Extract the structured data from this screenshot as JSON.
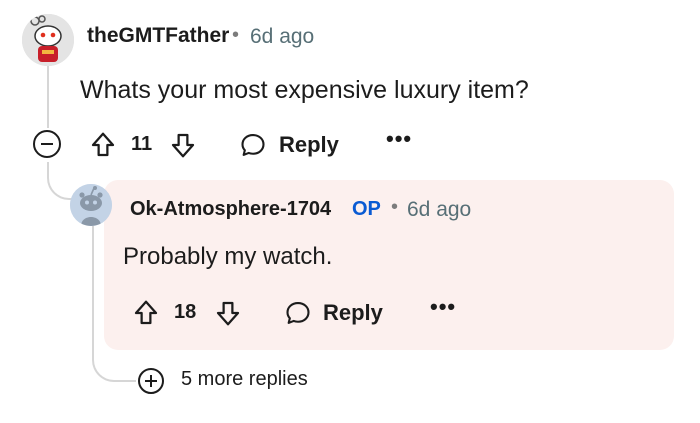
{
  "comment": {
    "username": "theGMTFather",
    "separator": "•",
    "time": "6d ago",
    "body": "Whats your most expensive luxury item?",
    "vote_count": "11",
    "reply_label": "Reply",
    "more_label": "•••"
  },
  "reply": {
    "username": "Ok-Atmosphere-1704",
    "badge": "OP",
    "separator": "•",
    "time": "6d ago",
    "body": "Probably my watch.",
    "vote_count": "18",
    "reply_label": "Reply",
    "more_label": "•••"
  },
  "more_replies": {
    "label": "5 more replies"
  },
  "colors": {
    "op_card_bg": "#fcf0ee",
    "op_badge": "#0a5bd3",
    "thread_line": "#d6d6d6",
    "meta_text": "#576f76"
  },
  "icons": [
    "upvote-icon",
    "downvote-icon",
    "comment-bubble-icon",
    "more-options-icon",
    "collapse-icon",
    "expand-plus-icon"
  ]
}
